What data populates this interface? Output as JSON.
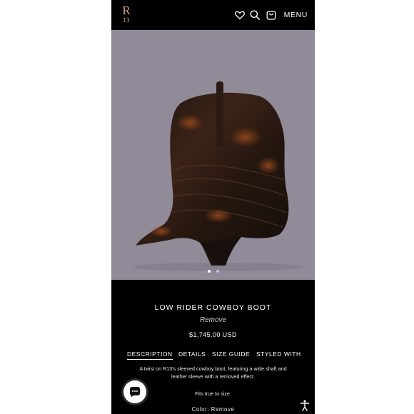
{
  "header": {
    "logo_top": "R",
    "logo_bottom": "13",
    "menu_label": "MENU",
    "icons": [
      "heart-icon",
      "search-icon",
      "bag-icon"
    ]
  },
  "hero": {
    "image_alt": "Low Rider Cowboy Boot",
    "carousel": {
      "current": 1,
      "total": 2
    }
  },
  "product": {
    "title": "LOW RIDER COWBOY BOOT",
    "color_name": "Remove",
    "price": "$1,745.00 USD"
  },
  "tabs": [
    {
      "label": "DESCRIPTION",
      "active": true
    },
    {
      "label": "DETAILS",
      "active": false
    },
    {
      "label": "SIZE GUIDE",
      "active": false
    },
    {
      "label": "STYLED WITH",
      "active": false
    }
  ],
  "description": {
    "line1": "A twist on R13's sleeved cowboy boot, featuring a wide shaft and",
    "line2": "leather sleeve with a removed effect.",
    "fit": "Fits true to size.",
    "color_line": "Color: Remove"
  },
  "colors": {
    "background": "#000000",
    "hero_bg": "#918a98",
    "logo": "#c9a27a",
    "text": "#ffffff"
  }
}
